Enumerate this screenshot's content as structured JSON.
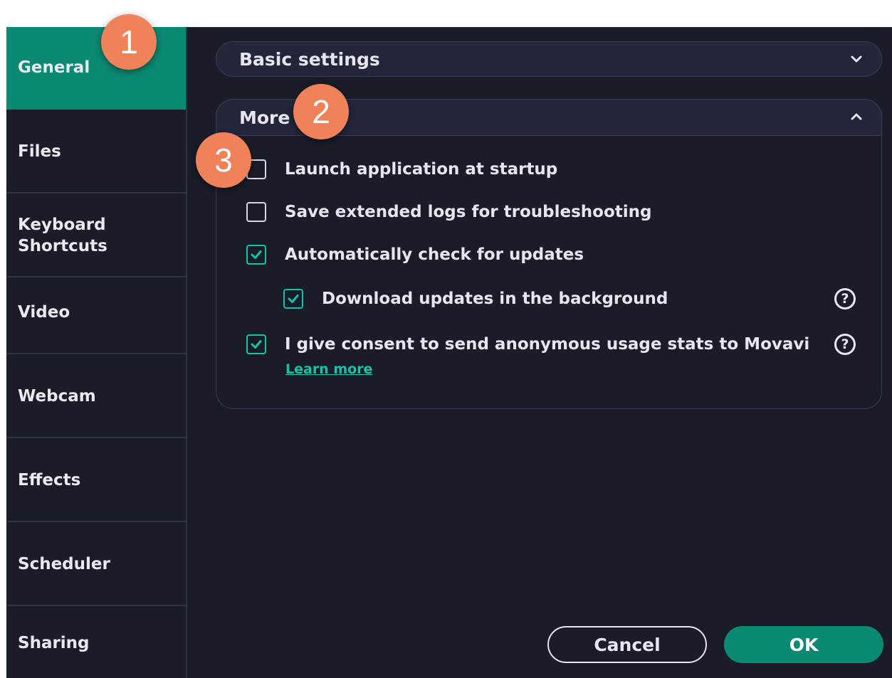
{
  "sidebar": {
    "items": [
      {
        "label": "General",
        "active": true
      },
      {
        "label": "Files",
        "active": false
      },
      {
        "label": "Keyboard\nShortcuts",
        "active": false
      },
      {
        "label": "Video",
        "active": false
      },
      {
        "label": "Webcam",
        "active": false
      },
      {
        "label": "Effects",
        "active": false
      },
      {
        "label": "Scheduler",
        "active": false
      },
      {
        "label": "Sharing",
        "active": false
      }
    ]
  },
  "sections": {
    "basic": {
      "title": "Basic settings",
      "expanded": false
    },
    "more": {
      "title": "More",
      "expanded": true,
      "options": [
        {
          "label": "Launch application at startup",
          "checked": false
        },
        {
          "label": "Save extended logs for troubleshooting",
          "checked": false
        },
        {
          "label": "Automatically check for updates",
          "checked": true
        },
        {
          "label": "Download updates in the background",
          "checked": true
        },
        {
          "label": "I give consent to send anonymous usage stats to Movavi",
          "checked": true
        }
      ],
      "help_icon": "?",
      "learn_more": "Learn more"
    }
  },
  "buttons": {
    "cancel": "Cancel",
    "ok": "OK"
  },
  "callouts": [
    "1",
    "2",
    "3"
  ],
  "colors": {
    "accent": "#0b8a73",
    "check": "#13c4aa",
    "background": "#1a1c27",
    "callout": "#f0825a"
  }
}
